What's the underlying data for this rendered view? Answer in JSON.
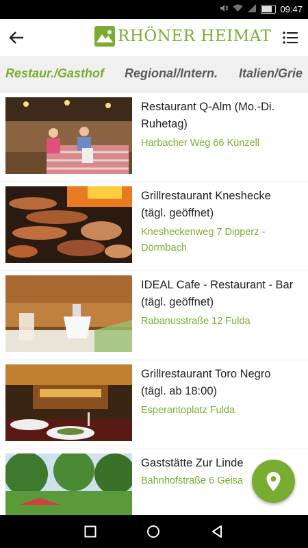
{
  "status_bar": {
    "time": "09:47"
  },
  "app": {
    "logo_text": "RHÖNER HEIMAT"
  },
  "tabs": [
    {
      "label": "Restaur./Gasthof",
      "active": true
    },
    {
      "label": "Regional/Intern.",
      "active": false
    },
    {
      "label": "Italien/Grie",
      "active": false
    }
  ],
  "restaurants": [
    {
      "name": "Restaurant Q-Alm (Mo.-Di. Ruhetag)",
      "address": "Harbacher Weg 66 Künzell"
    },
    {
      "name": "Grillrestaurant Kneshecke (tägl. geöffnet)",
      "address": "Kneshecken­weg 7 Dipperz - Dörmbach"
    },
    {
      "name": "IDEAL Cafe - Restaurant - Bar (tägl. geöffnet)",
      "address": "Rabanusstraße 12 Fulda"
    },
    {
      "name": "Grillrestaurant Toro Negro (tägl. ab 18:00)",
      "address": "Esperantoplatz Fulda"
    },
    {
      "name": "Gaststätte Zur Linde",
      "address": "Bahnhofstraße 6 Geisa"
    }
  ],
  "colors": {
    "accent": "#79ad32",
    "tab_bar_bg": "#f0f0f0",
    "status_bar_bg": "#000000"
  },
  "icons": [
    "back-arrow-icon",
    "list-menu-icon",
    "map-pin-icon",
    "nav-back-icon",
    "nav-home-icon",
    "nav-recents-icon"
  ]
}
